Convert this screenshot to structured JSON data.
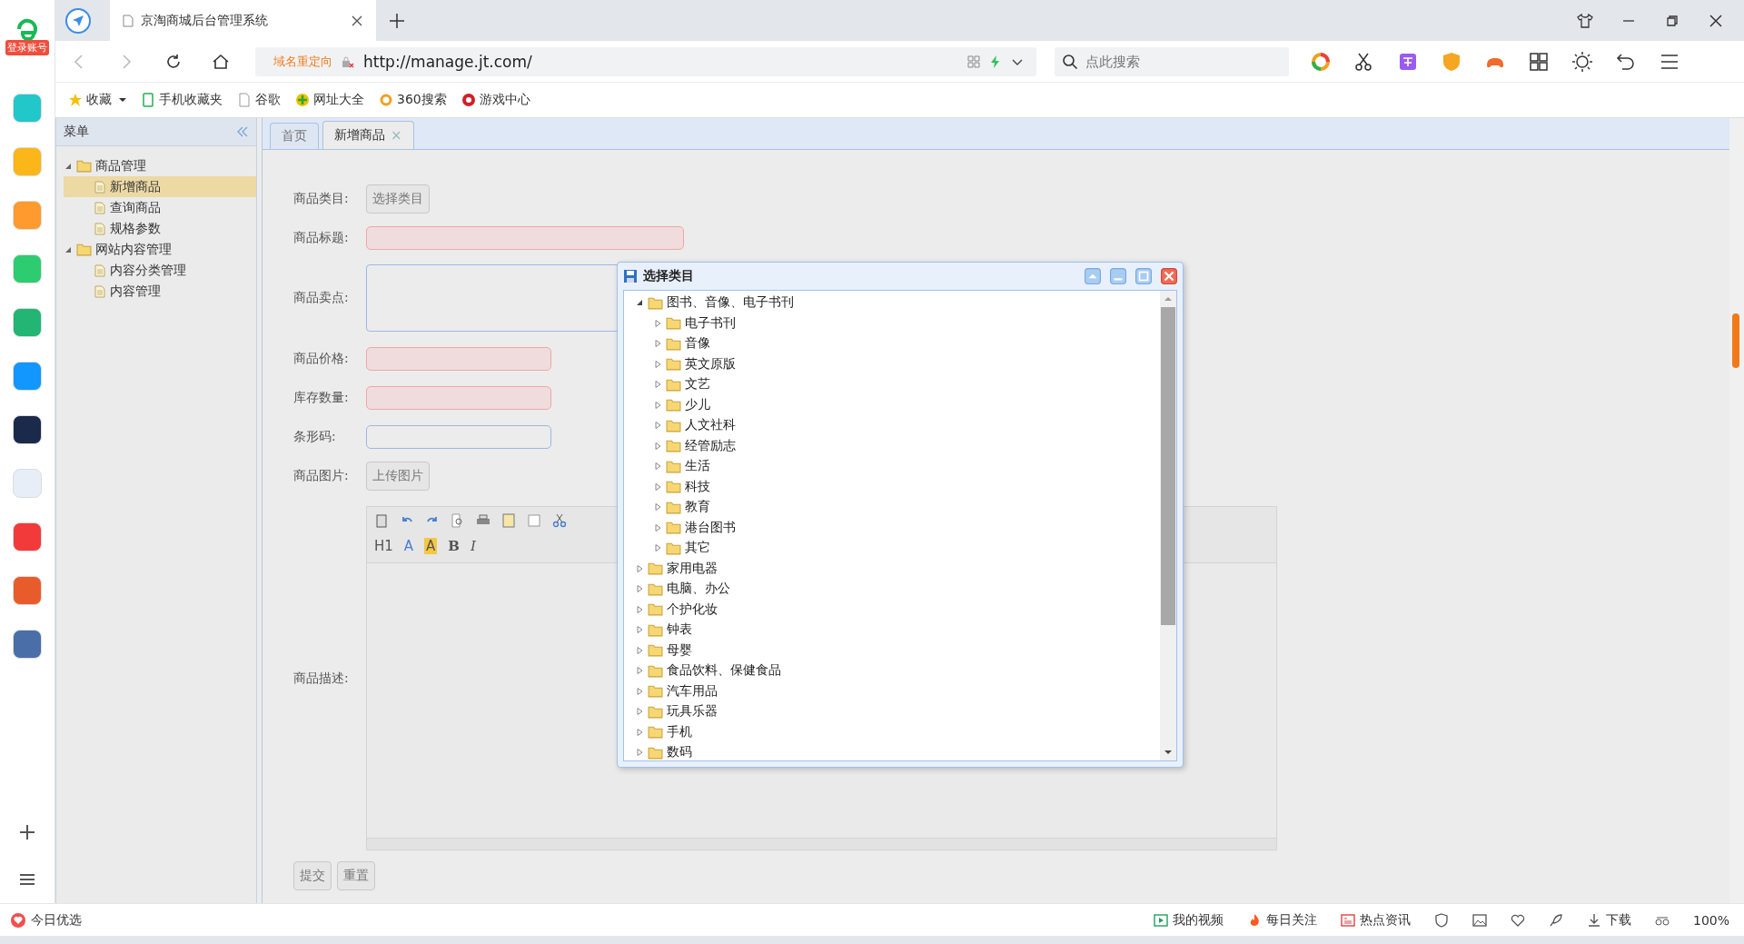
{
  "browser": {
    "login_badge": "登录账号",
    "tab_title": "京淘商城后台管理系统",
    "redirect_label": "域名重定向",
    "url": "http://manage.jt.com/",
    "search_placeholder": "点此搜索",
    "bookmarks": [
      {
        "label": "收藏",
        "kind": "star"
      },
      {
        "label": "手机收藏夹",
        "kind": "phone"
      },
      {
        "label": "谷歌",
        "kind": "page"
      },
      {
        "label": "网址大全",
        "kind": "plus"
      },
      {
        "label": "360搜索",
        "kind": "ring"
      },
      {
        "label": "游戏中心",
        "kind": "game"
      }
    ]
  },
  "menu": {
    "title": "菜单",
    "items": [
      {
        "label": "商品管理",
        "expanded": true,
        "children": [
          {
            "label": "新增商品",
            "selected": true
          },
          {
            "label": "查询商品",
            "selected": false
          },
          {
            "label": "规格参数",
            "selected": false
          }
        ]
      },
      {
        "label": "网站内容管理",
        "expanded": true,
        "children": [
          {
            "label": "内容分类管理",
            "selected": false
          },
          {
            "label": "内容管理",
            "selected": false
          }
        ]
      }
    ]
  },
  "tabs": [
    {
      "label": "首页",
      "selected": false
    },
    {
      "label": "新增商品",
      "selected": true,
      "close": "×"
    }
  ],
  "form": {
    "fields": [
      {
        "label": "商品类目:",
        "kind": "button",
        "button": "选择类目"
      },
      {
        "label": "商品标题:",
        "kind": "input",
        "wide": true,
        "required": true
      },
      {
        "label": "商品卖点:",
        "kind": "textarea",
        "required": false
      },
      {
        "label": "商品价格:",
        "kind": "input",
        "wide": false,
        "required": true
      },
      {
        "label": "库存数量:",
        "kind": "input",
        "wide": false,
        "required": true
      },
      {
        "label": "条形码:",
        "kind": "input",
        "wide": false,
        "required": false
      },
      {
        "label": "商品图片:",
        "kind": "button",
        "button": "上传图片"
      }
    ],
    "editor": {
      "label": "商品描述:",
      "toolbar_text": [
        {
          "label": "H1",
          "kind": "heading"
        },
        {
          "label": "A",
          "kind": "color"
        },
        {
          "label": "A",
          "kind": "highlight"
        },
        {
          "label": "B",
          "kind": "bold"
        },
        {
          "label": "I",
          "kind": "italic"
        }
      ]
    },
    "buttons": [
      "提交",
      "重置"
    ]
  },
  "dialog": {
    "title": "选择类目",
    "tree": [
      {
        "label": "图书、音像、电子书刊",
        "expanded": true,
        "children": [
          {
            "label": "电子书刊",
            "expanded": false
          },
          {
            "label": "音像",
            "expanded": false
          },
          {
            "label": "英文原版",
            "expanded": false
          },
          {
            "label": "文艺",
            "expanded": false
          },
          {
            "label": "少儿",
            "expanded": false
          },
          {
            "label": "人文社科",
            "expanded": false
          },
          {
            "label": "经管励志",
            "expanded": false
          },
          {
            "label": "生活",
            "expanded": false
          },
          {
            "label": "科技",
            "expanded": false
          },
          {
            "label": "教育",
            "expanded": false
          },
          {
            "label": "港台图书",
            "expanded": false
          },
          {
            "label": "其它",
            "expanded": false
          }
        ]
      },
      {
        "label": "家用电器",
        "expanded": false
      },
      {
        "label": "电脑、办公",
        "expanded": false
      },
      {
        "label": "个护化妆",
        "expanded": false
      },
      {
        "label": "钟表",
        "expanded": false
      },
      {
        "label": "母婴",
        "expanded": false
      },
      {
        "label": "食品饮料、保健食品",
        "expanded": false
      },
      {
        "label": "汽车用品",
        "expanded": false
      },
      {
        "label": "玩具乐器",
        "expanded": false
      },
      {
        "label": "手机",
        "expanded": false
      },
      {
        "label": "数码",
        "expanded": false
      }
    ]
  },
  "status_bar": {
    "left": "今日优选",
    "items": [
      {
        "label": "我的视频",
        "kind": "video"
      },
      {
        "label": "每日关注",
        "kind": "fire"
      },
      {
        "label": "热点资讯",
        "kind": "news"
      },
      {
        "label": "下载",
        "kind": "download"
      }
    ],
    "zoom": "100%"
  }
}
